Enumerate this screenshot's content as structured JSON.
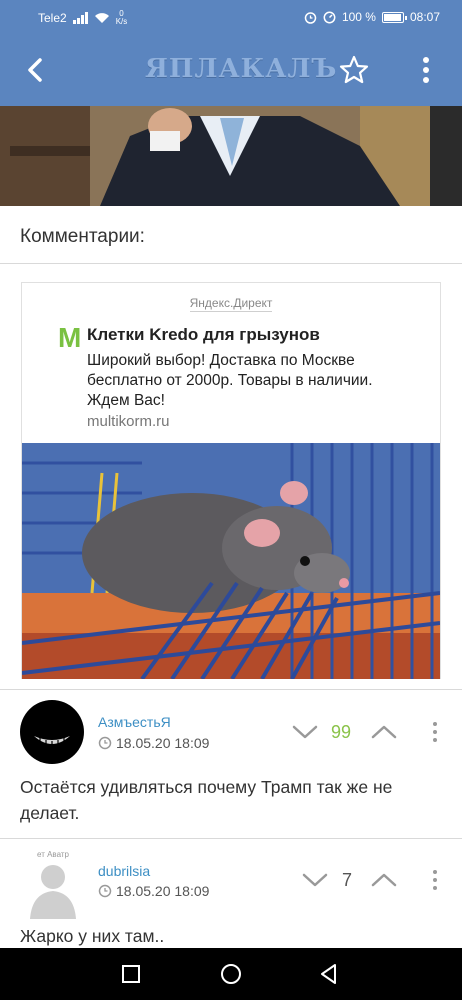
{
  "status_bar": {
    "carrier": "Tele2",
    "speed_value": "0",
    "speed_unit": "K/s",
    "battery_text": "100 %",
    "time": "08:07",
    "battery_level": 1.0
  },
  "app_bar": {
    "logo": "ЯПЛАКАЛЪ",
    "back_icon": "chevron-left-icon",
    "star_icon": "star-outline-icon",
    "menu_icon": "more-vertical-icon"
  },
  "comments_section": {
    "title": "Комментарии:"
  },
  "ad": {
    "source": "Яндекс.Директ",
    "logo_letter": "M",
    "title": "Клетки Kredo для грызунов",
    "text": "Широкий выбор! Доставка по Москве бесплатно от 2000р. Товары в наличии. Ждем Вас!",
    "domain": "multikorm.ru"
  },
  "comments": [
    {
      "username": "АзмъестьЯ",
      "date": "18.05.20 18:09",
      "score": "99",
      "score_color": "#8bc34a",
      "text": "Остаётся удивляться почему Трамп так же не делает."
    },
    {
      "username": "dubrilsia",
      "date": "18.05.20 18:09",
      "score": "7",
      "score_color": "#555555",
      "avatar_caption": "ет Аватр",
      "text": "Жарко у них там.."
    }
  ],
  "colors": {
    "header": "#5b85bf",
    "link": "#3d8fc4",
    "positive": "#8bc34a"
  }
}
